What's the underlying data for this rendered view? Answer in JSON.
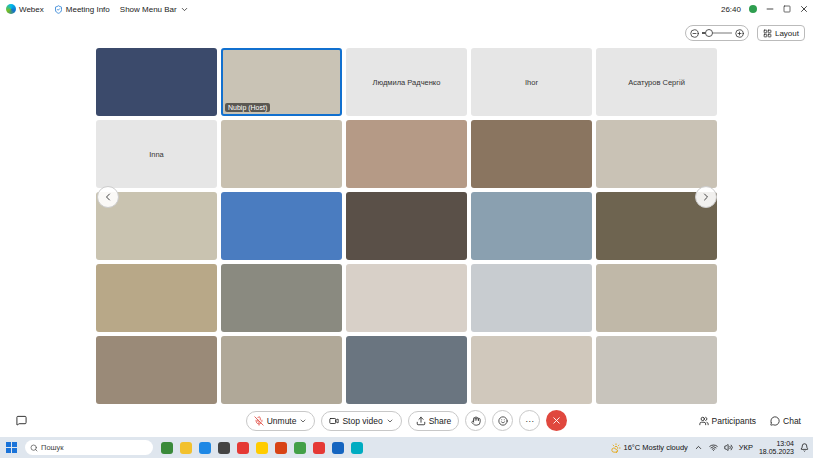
{
  "top_bar": {
    "app": "Webex",
    "meeting_info": "Meeting Info",
    "menu_bar": "Show Menu Bar",
    "timer": "26:40"
  },
  "zoom": {
    "level": 0.25
  },
  "layout_button": "Layout",
  "tiles": [
    {
      "kind": "video",
      "selected": false,
      "color": "#3b4a6b"
    },
    {
      "kind": "video",
      "selected": true,
      "color": "#c9c3b5",
      "label": "Nubip (Host)"
    },
    {
      "kind": "name",
      "selected": false,
      "label": "Людмила Радченко"
    },
    {
      "kind": "name",
      "selected": false,
      "label": "Ihor"
    },
    {
      "kind": "name",
      "selected": false,
      "label": "Асатуров Сергій"
    },
    {
      "kind": "name",
      "selected": false,
      "label": "Inna"
    },
    {
      "kind": "video",
      "selected": false,
      "color": "#c8c0b0"
    },
    {
      "kind": "video",
      "selected": false,
      "color": "#b59a86"
    },
    {
      "kind": "video",
      "selected": false,
      "color": "#8a7560"
    },
    {
      "kind": "video",
      "selected": false,
      "color": "#c9c2b5"
    },
    {
      "kind": "video",
      "selected": false,
      "color": "#c9c3b0"
    },
    {
      "kind": "video",
      "selected": false,
      "color": "#4a7cc0"
    },
    {
      "kind": "video",
      "selected": false,
      "color": "#5a5048"
    },
    {
      "kind": "video",
      "selected": false,
      "color": "#8aa0b0"
    },
    {
      "kind": "video",
      "selected": false,
      "color": "#6e6450"
    },
    {
      "kind": "video",
      "selected": false,
      "color": "#b8a888"
    },
    {
      "kind": "video",
      "selected": false,
      "color": "#8a8a80"
    },
    {
      "kind": "video",
      "selected": false,
      "color": "#d8d0c8"
    },
    {
      "kind": "video",
      "selected": false,
      "color": "#c8ccd0"
    },
    {
      "kind": "video",
      "selected": false,
      "color": "#c0b8a8"
    },
    {
      "kind": "video",
      "selected": false,
      "color": "#9a8a78"
    },
    {
      "kind": "video",
      "selected": false,
      "color": "#b0a898"
    },
    {
      "kind": "video",
      "selected": false,
      "color": "#6a7580"
    },
    {
      "kind": "video",
      "selected": false,
      "color": "#d0c8bc"
    },
    {
      "kind": "video",
      "selected": false,
      "color": "#c8c4bc"
    }
  ],
  "controls": {
    "unmute": {
      "label": "Unmute",
      "muted": true
    },
    "video": "Stop video",
    "share": "Share",
    "more": "···",
    "participants": "Participants",
    "chat": "Chat"
  },
  "taskbar": {
    "search": "Пошук",
    "weather": "16°C Mostly cloudy",
    "language": "УКР",
    "time": "13:04",
    "date": "18.05.2023"
  }
}
